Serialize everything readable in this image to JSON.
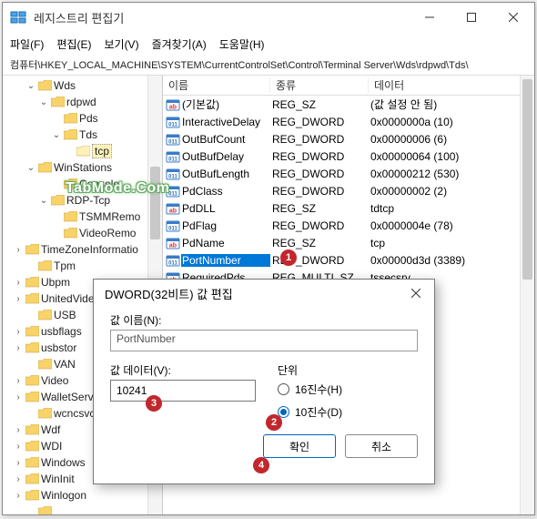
{
  "window": {
    "title": "레지스트리 편집기"
  },
  "menu": {
    "file": "파일(F)",
    "edit": "편집(E)",
    "view": "보기(V)",
    "fav": "즐겨찾기(A)",
    "help": "도움말(H)"
  },
  "address": "컴퓨터\\HKEY_LOCAL_MACHINE\\SYSTEM\\CurrentControlSet\\Control\\Terminal Server\\Wds\\rdpwd\\Tds\\",
  "tree": [
    {
      "ind": 24,
      "chev": "v",
      "label": "Wds"
    },
    {
      "ind": 38,
      "chev": "v",
      "label": "rdpwd"
    },
    {
      "ind": 52,
      "chev": "",
      "label": "Pds"
    },
    {
      "ind": 52,
      "chev": "v",
      "label": "Tds"
    },
    {
      "ind": 66,
      "chev": "",
      "label": "tcp",
      "hl": true
    },
    {
      "ind": 24,
      "chev": "v",
      "label": "WinStations"
    },
    {
      "ind": 52,
      "chev": "",
      "label": "Console"
    },
    {
      "ind": 38,
      "chev": "v",
      "label": "RDP-Tcp"
    },
    {
      "ind": 52,
      "chev": "",
      "label": "TSMMRemo"
    },
    {
      "ind": 52,
      "chev": "",
      "label": "VideoRemo"
    },
    {
      "ind": 10,
      "chev": ">",
      "label": "TimeZoneInformatio"
    },
    {
      "ind": 24,
      "chev": "",
      "label": "Tpm"
    },
    {
      "ind": 10,
      "chev": ">",
      "label": "Ubpm"
    },
    {
      "ind": 10,
      "chev": ">",
      "label": "UnitedVide"
    },
    {
      "ind": 24,
      "chev": "",
      "label": "USB"
    },
    {
      "ind": 10,
      "chev": ">",
      "label": "usbflags"
    },
    {
      "ind": 10,
      "chev": ">",
      "label": "usbstor"
    },
    {
      "ind": 24,
      "chev": "",
      "label": "VAN"
    },
    {
      "ind": 10,
      "chev": ">",
      "label": "Video"
    },
    {
      "ind": 10,
      "chev": ">",
      "label": "WalletServ"
    },
    {
      "ind": 24,
      "chev": "",
      "label": "wcncsvc"
    },
    {
      "ind": 10,
      "chev": ">",
      "label": "Wdf"
    },
    {
      "ind": 10,
      "chev": ">",
      "label": "WDI"
    },
    {
      "ind": 10,
      "chev": ">",
      "label": "Windows"
    },
    {
      "ind": 10,
      "chev": ">",
      "label": "WinInit"
    },
    {
      "ind": 10,
      "chev": ">",
      "label": "Winlogon"
    },
    {
      "ind": 24,
      "chev": "",
      "label": ""
    }
  ],
  "list": {
    "headers": {
      "name": "이름",
      "type": "종류",
      "data": "데이터"
    },
    "rows": [
      {
        "icon": "ab",
        "name": "(기본값)",
        "type": "REG_SZ",
        "data": "(값 설정 안 됨)"
      },
      {
        "icon": "01",
        "name": "InteractiveDelay",
        "type": "REG_DWORD",
        "data": "0x0000000a (10)"
      },
      {
        "icon": "01",
        "name": "OutBufCount",
        "type": "REG_DWORD",
        "data": "0x00000006 (6)"
      },
      {
        "icon": "01",
        "name": "OutBufDelay",
        "type": "REG_DWORD",
        "data": "0x00000064 (100)"
      },
      {
        "icon": "01",
        "name": "OutBufLength",
        "type": "REG_DWORD",
        "data": "0x00000212 (530)"
      },
      {
        "icon": "01",
        "name": "PdClass",
        "type": "REG_DWORD",
        "data": "0x00000002 (2)"
      },
      {
        "icon": "ab",
        "name": "PdDLL",
        "type": "REG_SZ",
        "data": "tdtcp"
      },
      {
        "icon": "01",
        "name": "PdFlag",
        "type": "REG_DWORD",
        "data": "0x0000004e (78)"
      },
      {
        "icon": "ab",
        "name": "PdName",
        "type": "REG_SZ",
        "data": "tcp"
      },
      {
        "icon": "01",
        "name": "PortNumber",
        "type": "REG_DWORD",
        "data": "0x00000d3d (3389)",
        "sel": true
      },
      {
        "icon": "ab",
        "name": "RequiredPds",
        "type": "REG_MULTI_SZ",
        "data": "tssecsrv"
      }
    ]
  },
  "dialog": {
    "title": "DWORD(32비트) 값 편집",
    "name_label": "값 이름(N):",
    "name_value": "PortNumber",
    "data_label": "값 데이터(V):",
    "data_value": "10241",
    "unit_label": "단위",
    "radio_hex": "16진수(H)",
    "radio_dec": "10진수(D)",
    "ok": "확인",
    "cancel": "취소"
  },
  "badges": {
    "b1": "1",
    "b2": "2",
    "b3": "3",
    "b4": "4"
  },
  "watermark": "TabMode.Com"
}
